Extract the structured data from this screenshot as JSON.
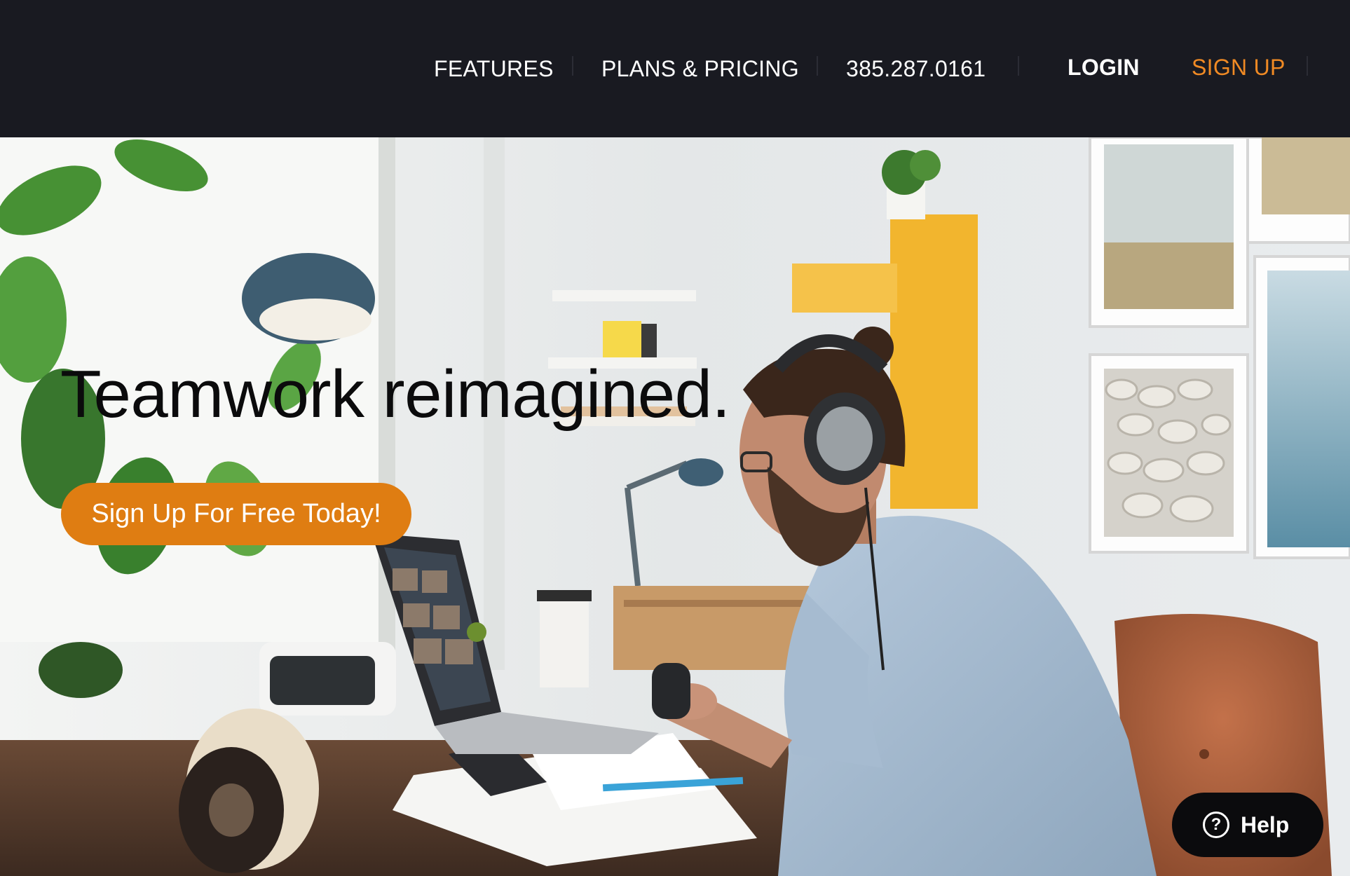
{
  "nav": {
    "features": "FEATURES",
    "plans": "PLANS & PRICING",
    "phone": "385.287.0161",
    "login": "LOGIN",
    "signup": "SIGN UP"
  },
  "hero": {
    "headline": "Teamwork reimagined.",
    "cta": "Sign Up For Free Today!",
    "image_description_icon": "office-photo"
  },
  "help": {
    "icon_glyph": "?",
    "label": "Help"
  },
  "colors": {
    "nav_bg": "#191a21",
    "accent": "#df7d12",
    "signup_text": "#f08a24",
    "help_bg": "#0b0b0d"
  }
}
